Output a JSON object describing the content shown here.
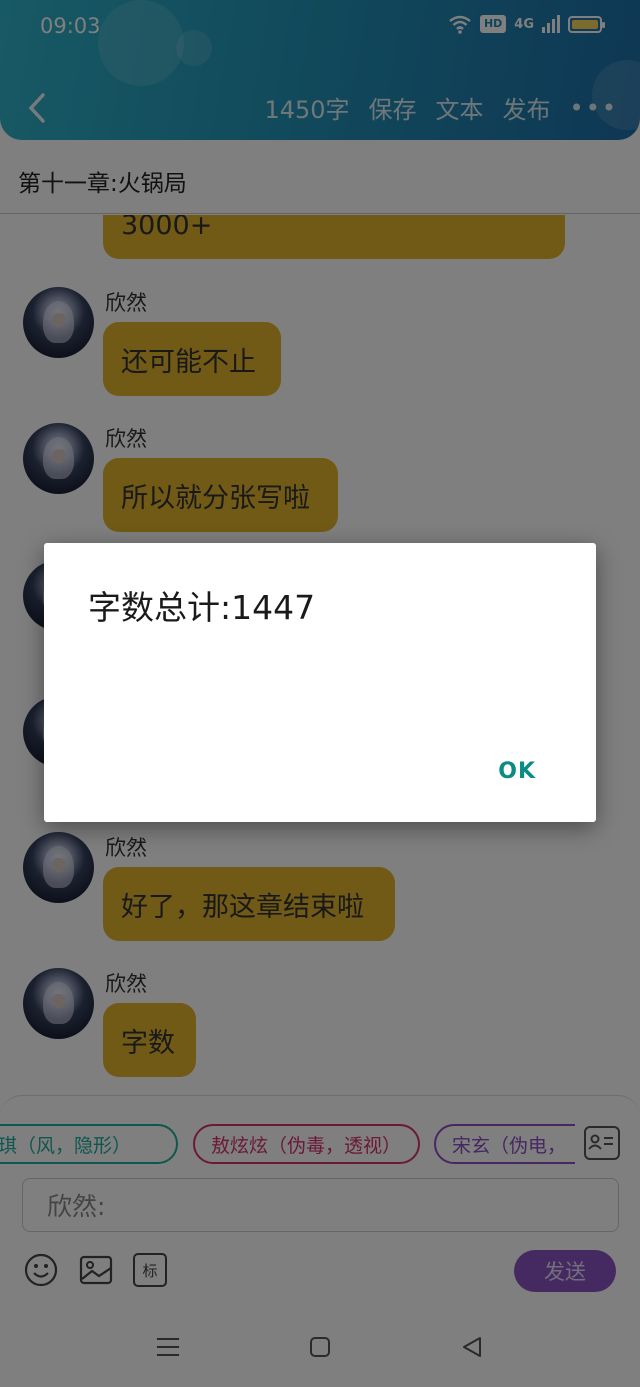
{
  "status_bar": {
    "time": "09:03",
    "hd": "HD",
    "signal": "4G"
  },
  "header": {
    "word_count": "1450字",
    "save": "保存",
    "text": "文本",
    "publish": "发布",
    "more": "•••"
  },
  "chapter": {
    "title": "第十一章:火锅局"
  },
  "messages": [
    {
      "text": "3000+"
    },
    {
      "name": "欣然",
      "text": "还可能不止"
    },
    {
      "name": "欣然",
      "text": "所以就分张写啦"
    },
    {
      "name": "欣然",
      "text": "好了，那这章结束啦"
    },
    {
      "name": "欣然",
      "text": "字数"
    }
  ],
  "compose": {
    "characters": [
      {
        "label": "琪（风，隐形）",
        "color": "#1fae9c"
      },
      {
        "label": "敖炫炫（伪毒，透视）",
        "color": "#d6336e"
      },
      {
        "label": "宋玄（伪电，",
        "color": "#8e4fc4"
      }
    ],
    "input_placeholder": "欣然:",
    "tool_mark": "标",
    "send": "发送"
  },
  "dialog": {
    "message": "字数总计:1447",
    "ok": "OK"
  },
  "colors": {
    "accent": "#2395b8",
    "bubble": "#e3b52d",
    "send": "#8b54c4",
    "dialog_ok": "#0a8c84"
  }
}
